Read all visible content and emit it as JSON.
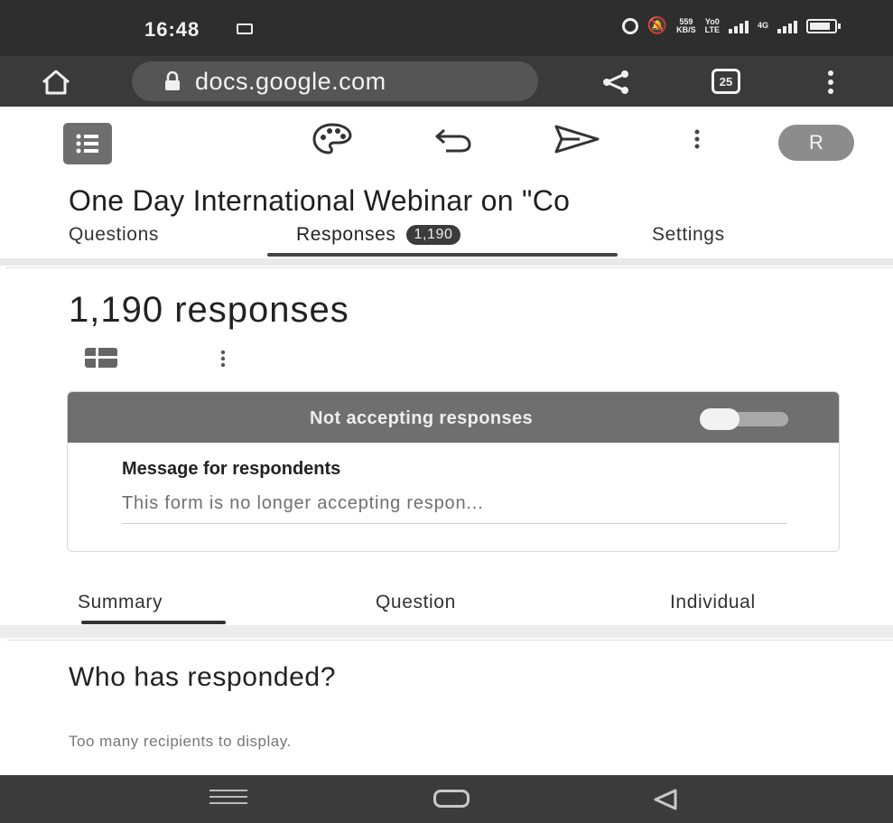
{
  "status_bar": {
    "time": "16:48",
    "network_speed_top": "559",
    "network_speed_unit": "KB/S",
    "volte_top": "Yo0",
    "volte_bottom": "LTE",
    "signal_label": "4G"
  },
  "browser": {
    "url": "docs.google.com",
    "tab_count": "25",
    "icons": [
      "home-icon",
      "lock-icon",
      "share-icon",
      "tabs-icon",
      "kebab-icon"
    ]
  },
  "toolbar": {
    "avatar_initial": "R",
    "icons": [
      "forms-logo-icon",
      "palette-icon",
      "undo-icon",
      "send-icon",
      "more-vert-icon"
    ]
  },
  "form": {
    "title": "One Day International Webinar on  \"Co"
  },
  "tabs": {
    "questions": "Questions",
    "responses": "Responses",
    "responses_badge": "1,190",
    "settings": "Settings",
    "active": "Responses"
  },
  "responses": {
    "count_heading": "1,190 responses",
    "accepting_label": "Not accepting responses",
    "accepting_on": false,
    "message_label": "Message for respondents",
    "message_text": "This form is no longer accepting respon..."
  },
  "sub_tabs": {
    "summary": "Summary",
    "question": "Question",
    "individual": "Individual",
    "active": "Summary"
  },
  "who": {
    "title": "Who has responded?",
    "text": "Too many recipients to display."
  },
  "colors": {
    "status_bar": "#2e2e2e",
    "browser_bar": "#3a3a3a",
    "accept_bar": "#6f6f6f",
    "nav_bar": "#3b3b3b"
  }
}
